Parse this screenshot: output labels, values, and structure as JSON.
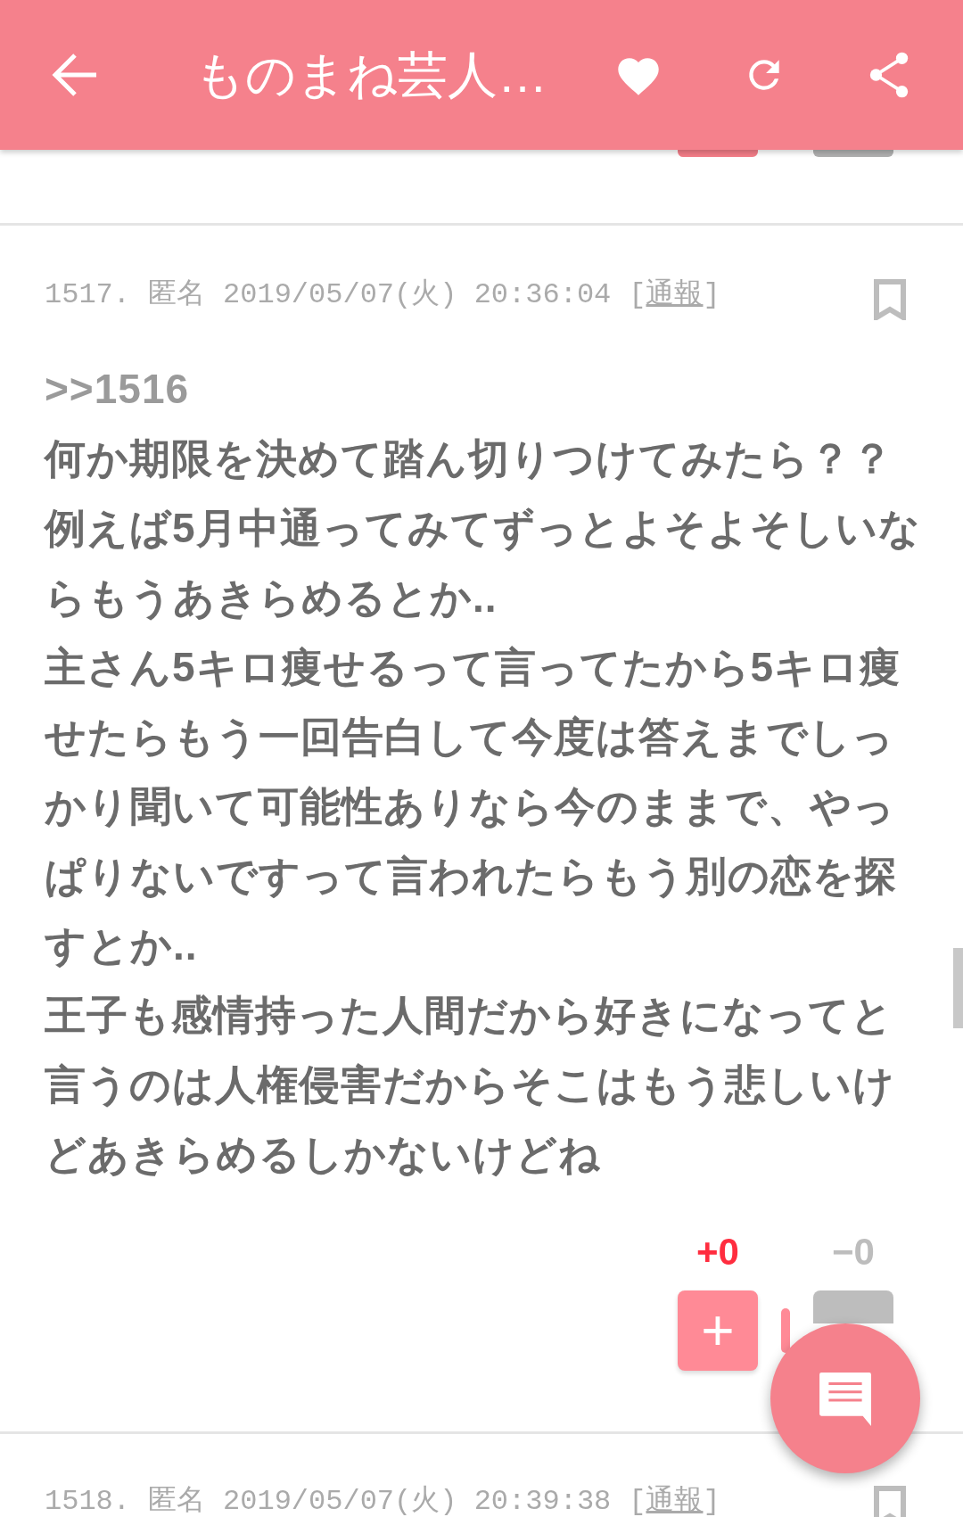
{
  "app_bar": {
    "title": "ものまね芸人…"
  },
  "posts": [
    {
      "number": "1517.",
      "author": "匿名",
      "date": "2019/05/07(火) 20:36:04",
      "report_open": "[",
      "report": "通報",
      "report_close": "]",
      "bookmarked": false,
      "anchor": ">>1516",
      "paragraphs": [
        "何か期限を決めて踏ん切りつけてみたら？？",
        "例えば5月中通ってみてずっとよそよそしいならもうあきらめるとか..",
        "主さん5キロ痩せるって言ってたから5キロ痩せたらもう一回告白して今度は答えまでしっかり聞いて可能性ありなら今のままで、やっぱりないですって言われたらもう別の恋を探すとか..",
        "王子も感情持った人間だから好きになってと言うのは人権侵害だからそこはもう悲しいけどあきらめるしかないけどね"
      ],
      "plus_count": "+0",
      "minus_count": "−0",
      "plus_sign": "+"
    },
    {
      "number": "1518.",
      "author": "匿名",
      "date": "2019/05/07(火) 20:39:38",
      "report_open": "[",
      "report": "通報",
      "report_close": "]",
      "bookmarked": false
    }
  ]
}
